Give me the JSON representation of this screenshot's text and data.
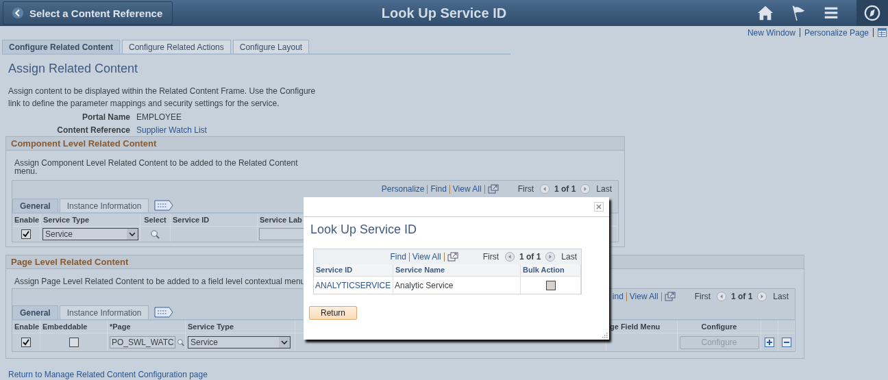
{
  "header": {
    "back_button": "Select a Content Reference",
    "title": "Look Up Service ID"
  },
  "links": [
    "New Window",
    "Personalize Page"
  ],
  "tabs": [
    {
      "label": "Configure Related Content",
      "selected": true
    },
    {
      "label": "Configure Related Actions",
      "selected": false
    },
    {
      "label": "Configure Layout",
      "selected": false
    }
  ],
  "page_title": "Assign Related Content",
  "description": "Assign content to be displayed within the Related Content Frame. Use the Configure link to define the parameter mappings and security settings for the service.",
  "fields": [
    {
      "label": "Portal Name",
      "value": "EMPLOYEE",
      "kind": "text"
    },
    {
      "label": "Content Reference",
      "value": "Supplier Watch List",
      "kind": "link"
    }
  ],
  "component_section": {
    "title": "Component Level Related Content",
    "description": "Assign Component Level Related Content to be added to the Related Content menu.",
    "toolbar": {
      "links": [
        "Personalize",
        "Find",
        "View All"
      ],
      "first": "First",
      "count": "1 of 1",
      "last": "Last"
    },
    "tabs": [
      {
        "label": "General",
        "selected": true
      },
      {
        "label": "Instance Information",
        "selected": false
      }
    ],
    "columns": [
      "Enable",
      "Service Type",
      "Select",
      "Service ID",
      "Service Lab"
    ],
    "rows": [
      {
        "enabled": true,
        "service_type": "Service"
      }
    ]
  },
  "page_section": {
    "title": "Page Level Related Content",
    "description": "Assign Page Level Related Content to be added to a field level contextual menu",
    "toolbar": {
      "links": [
        "ind",
        "View All"
      ],
      "first": "First",
      "count": "1 of 1",
      "last": "Last"
    },
    "tabs": [
      {
        "label": "General",
        "selected": true
      },
      {
        "label": "Instance Information",
        "selected": false
      }
    ],
    "columns": [
      "Enable",
      "Embeddable",
      "*Page",
      "Service Type",
      "ge Field Menu",
      "Configure"
    ],
    "rows": [
      {
        "enabled": true,
        "embeddable": false,
        "page": "PO_SWL_WATC",
        "service_type": "Service",
        "configure": "Configure",
        "configure_disabled": true
      }
    ]
  },
  "modal": {
    "title": "Look Up Service ID",
    "toolbar": {
      "links": [
        "Find",
        "View All"
      ],
      "first": "First",
      "count": "1 of 1",
      "last": "Last"
    },
    "columns": [
      "Service ID",
      "Service Name",
      "Bulk Action"
    ],
    "rows": [
      {
        "service_id": "ANALYTICSERVICE",
        "service_name": "Analytic Service",
        "bulk_action": false
      }
    ],
    "return_button": "Return"
  },
  "footer_link": "Return to Manage Related Content Configuration page"
}
